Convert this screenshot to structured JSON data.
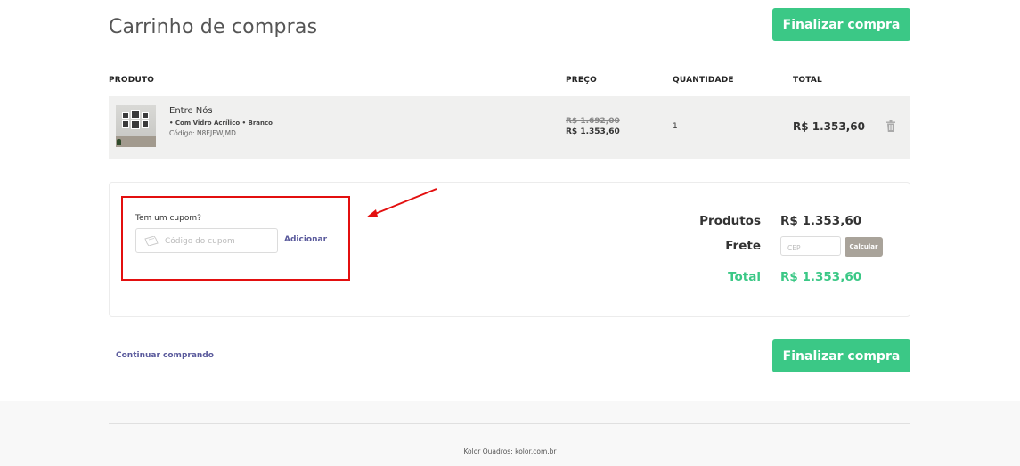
{
  "page": {
    "title": "Carrinho de compras",
    "checkout_label": "Finalizar compra"
  },
  "table": {
    "headers": [
      "PRODUTO",
      "PREÇO",
      "QUANTIDADE",
      "TOTAL"
    ]
  },
  "items": [
    {
      "name": "Entre Nós",
      "variant": "• Com Vidro Acrílico • Branco",
      "code": "Código: N8EJEWJMD",
      "price_old": "R$ 1.692,00",
      "price_new": "R$ 1.353,60",
      "quantity": "1",
      "total": "R$ 1.353,60"
    }
  ],
  "coupon": {
    "label": "Tem um cupom?",
    "placeholder": "Código do cupom",
    "button": "Adicionar"
  },
  "summary": {
    "products_label": "Produtos",
    "products_value": "R$ 1.353,60",
    "shipping_label": "Frete",
    "cep_placeholder": "CEP",
    "calculate_label": "Calcular",
    "total_label": "Total",
    "total_value": "R$ 1.353,60"
  },
  "continue_shopping": "Continuar comprando",
  "footer": {
    "text": "Kolor Quadros: kolor.com.br"
  },
  "colors": {
    "accent_green": "#3bc886",
    "link_purple": "#5a5a9c",
    "annotation_red": "#e30f0f",
    "calcular_bg": "#a9a39a"
  },
  "icons": {
    "trash": "trash-icon",
    "coupon": "ticket-icon",
    "annotation": "arrow-annotation"
  }
}
